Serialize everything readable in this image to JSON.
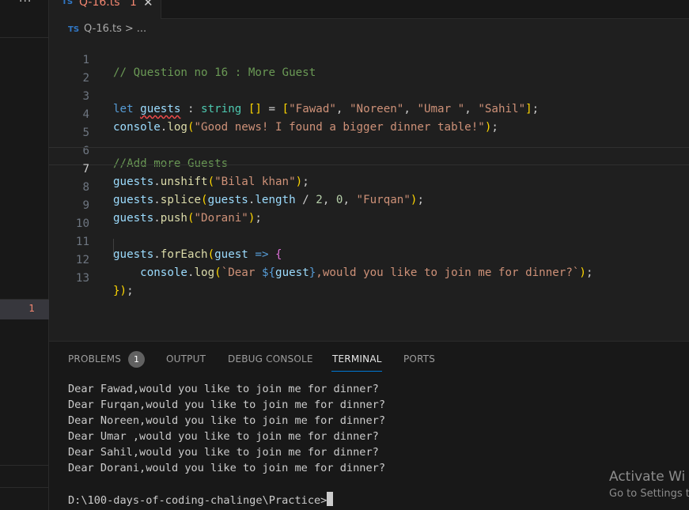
{
  "sidebar": {
    "more_glyph": "···",
    "problems_count": "1"
  },
  "tab": {
    "lang_badge": "TS",
    "file_name": "Q-16.ts",
    "error_count": "1",
    "close_glyph": "✕"
  },
  "breadcrumb": {
    "lang_badge": "TS",
    "file": "Q-16.ts",
    "separator": ">",
    "more": "..."
  },
  "editor": {
    "current_line": 7,
    "lines": [
      {
        "n": "1",
        "text": "// Question no 16 : More Guest"
      },
      {
        "n": "2",
        "text": ""
      },
      {
        "n": "3",
        "text": "let guests : string [] = [\"Fawad\", \"Noreen\", \"Umar \", \"Sahil\"];"
      },
      {
        "n": "4",
        "text": "console.log(\"Good news! I found a bigger dinner table!\");"
      },
      {
        "n": "5",
        "text": ""
      },
      {
        "n": "6",
        "text": "//Add more Guests"
      },
      {
        "n": "7",
        "text": "guests.unshift(\"Bilal khan\");"
      },
      {
        "n": "8",
        "text": "guests.splice(guests.length / 2, 0, \"Furqan\");"
      },
      {
        "n": "9",
        "text": "guests.push(\"Dorani\");"
      },
      {
        "n": "10",
        "text": ""
      },
      {
        "n": "11",
        "text": "guests.forEach(guest => {"
      },
      {
        "n": "12",
        "text": "    console.log(`Dear ${guest},would you like to join me for dinner?`);"
      },
      {
        "n": "13",
        "text": "});"
      }
    ]
  },
  "panel": {
    "tabs": [
      {
        "label": "PROBLEMS",
        "active": false
      },
      {
        "label": "OUTPUT",
        "active": false
      },
      {
        "label": "DEBUG CONSOLE",
        "active": false
      },
      {
        "label": "TERMINAL",
        "active": true
      },
      {
        "label": "PORTS",
        "active": false
      }
    ],
    "problems_badge": "1",
    "terminal_lines": [
      "Dear Fawad,would you like to join me for dinner?",
      "Dear Furqan,would you like to join me for dinner?",
      "Dear Noreen,would you like to join me for dinner?",
      "Dear Umar ,would you like to join me for dinner?",
      "Dear Sahil,would you like to join me for dinner?",
      "Dear Dorani,would you like to join me for dinner?"
    ],
    "prompt": "D:\\100-days-of-coding-chalinge\\Practice>"
  },
  "watermark": {
    "line1": "Activate Wi",
    "line2": "Go to Settings t"
  },
  "colors": {
    "accent": "#0078d4",
    "error": "#f48771",
    "ts_blue": "#3178c6",
    "background": "#1f1f1f"
  }
}
